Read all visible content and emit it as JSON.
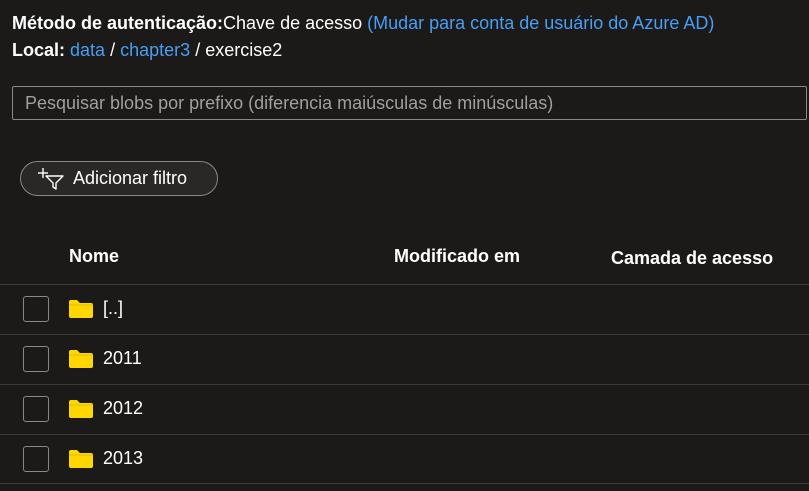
{
  "auth": {
    "label": "Método de autenticação:",
    "value": "Chave de acesso",
    "switch_link": "(Mudar para conta de usuário do Azure AD)"
  },
  "location": {
    "label": "Local:",
    "breadcrumb": [
      "data",
      "chapter3",
      "exercise2"
    ]
  },
  "search": {
    "placeholder": "Pesquisar blobs por prefixo (diferencia maiúsculas de minúsculas)"
  },
  "filter_button": {
    "label": "Adicionar filtro",
    "icon": "add-filter-icon"
  },
  "table": {
    "columns": [
      "Nome",
      "Modificado em",
      "Camada de acesso"
    ],
    "rows": [
      {
        "name": "[..]",
        "icon": "folder-icon"
      },
      {
        "name": "2011",
        "icon": "folder-icon"
      },
      {
        "name": "2012",
        "icon": "folder-icon"
      },
      {
        "name": "2013",
        "icon": "folder-icon"
      }
    ]
  },
  "colors": {
    "background": "#1b1a19",
    "link": "#479ef5",
    "folder": "#ffd700",
    "border": "#8a8886"
  }
}
